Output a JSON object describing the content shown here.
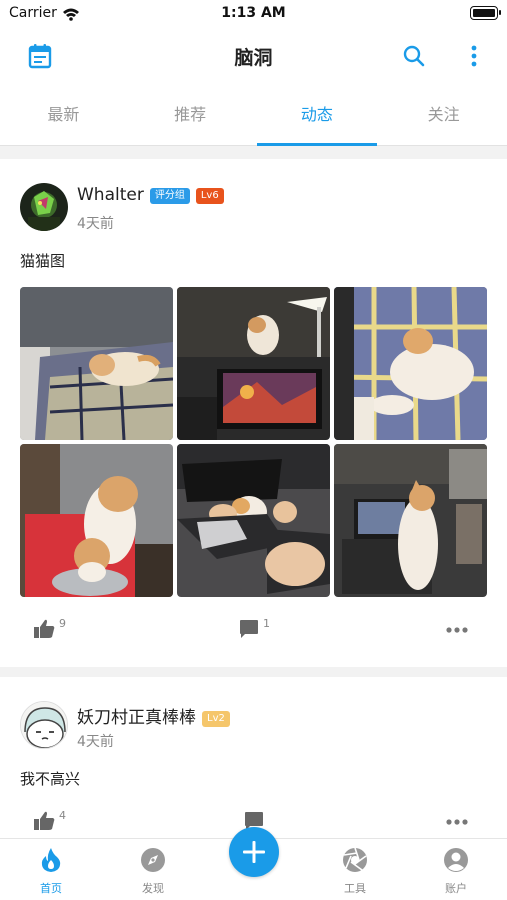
{
  "status_bar": {
    "carrier": "Carrier",
    "time": "1:13 AM"
  },
  "header": {
    "title": "脑洞",
    "calendar_icon": "calendar-icon",
    "search_icon": "search-icon",
    "more_icon": "more-vertical-icon"
  },
  "tabs": [
    {
      "label": "最新",
      "active": false
    },
    {
      "label": "推荐",
      "active": false
    },
    {
      "label": "动态",
      "active": true
    },
    {
      "label": "关注",
      "active": false
    }
  ],
  "posts": [
    {
      "author": "Whalter",
      "badges": [
        {
          "label": "评分组",
          "color": "#2b9be8"
        },
        {
          "label": "Lv6",
          "color": "#e8531c"
        }
      ],
      "time": "4天前",
      "text": "猫猫图",
      "photo_count": 6,
      "likes": "9",
      "comments": "1"
    },
    {
      "author": "妖刀村正真棒棒",
      "badges": [
        {
          "label": "Lv2",
          "color": "#f5c66b"
        }
      ],
      "time": "4天前",
      "text": "我不高兴",
      "likes": "4",
      "comments": ""
    }
  ],
  "tab_bar": {
    "items": [
      {
        "label": "首页",
        "icon": "flame-icon",
        "active": true
      },
      {
        "label": "发现",
        "icon": "compass-icon",
        "active": false
      },
      {
        "label": "",
        "icon": "plus-icon",
        "active": false
      },
      {
        "label": "工具",
        "icon": "aperture-icon",
        "active": false
      },
      {
        "label": "账户",
        "icon": "account-icon",
        "active": false
      }
    ]
  },
  "colors": {
    "accent": "#1a9be8",
    "badge_blue": "#2b9be8",
    "badge_red": "#e8531c",
    "badge_gold": "#f5c66b"
  }
}
